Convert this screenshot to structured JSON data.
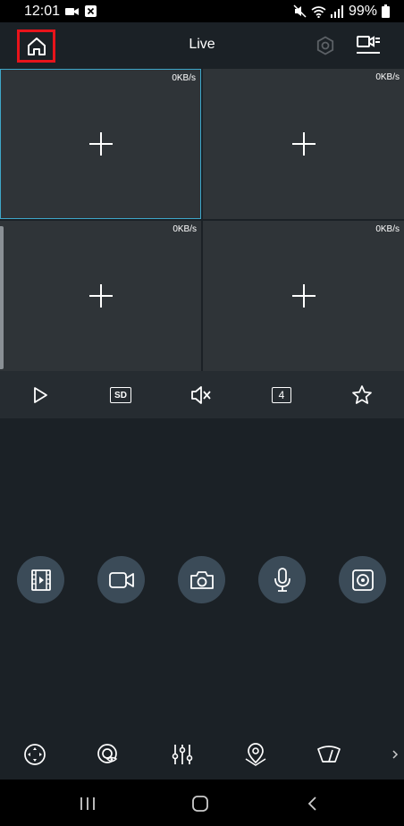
{
  "status_bar": {
    "time": "12:01",
    "battery": "99%"
  },
  "header": {
    "title": "Live"
  },
  "grid": {
    "cells": [
      {
        "rate": "0KB/s"
      },
      {
        "rate": "0KB/s"
      },
      {
        "rate": "0KB/s"
      },
      {
        "rate": "0KB/s"
      }
    ]
  },
  "toolbar": {
    "sd_label": "SD",
    "split_label": "4"
  },
  "icons": {
    "header": [
      "home-icon",
      "gear-icon",
      "camera-list-icon"
    ],
    "toolbar": [
      "play-icon",
      "sd-quality-icon",
      "mute-icon",
      "split-screen-icon",
      "favorite-star-icon"
    ],
    "actions": [
      "playback-film-icon",
      "record-video-icon",
      "snapshot-camera-icon",
      "microphone-icon",
      "fisheye-icon"
    ],
    "bottom": [
      "ptz-icon",
      "focus-eye-icon",
      "image-adjust-sliders-icon",
      "preset-location-icon",
      "wiper-icon",
      "chevron-right-icon"
    ]
  },
  "colors": {
    "accent": "#3ea6c8",
    "highlight": "#e8141b"
  }
}
